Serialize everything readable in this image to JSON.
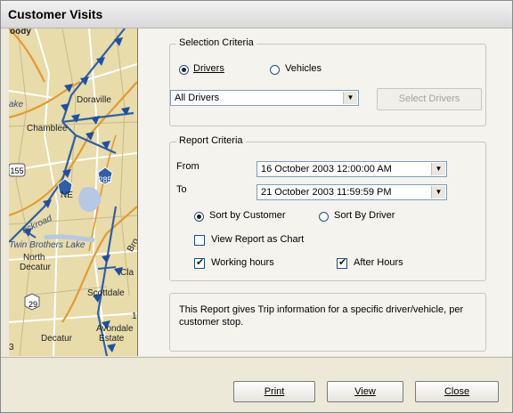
{
  "window": {
    "title": "Customer Visits"
  },
  "map": {
    "labels": {
      "top": "oody",
      "doraville": "Doraville",
      "lake": "ake",
      "chamblee": "Chamblee",
      "ne": "NE",
      "hwy155": "155",
      "hwy285": "285",
      "crossroad": "ackroad",
      "twin_brothers": "Twin Brothers Lake",
      "north_decatur_1": "North",
      "north_decatur_2": "Decatur",
      "cla": "Cla",
      "scottdale": "Scottdale",
      "hwy29": "29",
      "decatur": "Decatur",
      "avondale_1": "Avondale",
      "avondale_2": "Estate",
      "edge_1": "1",
      "edge_3": "3",
      "bro": "Bro"
    }
  },
  "selection_criteria": {
    "title": "Selection Criteria",
    "drivers_label": "Drivers",
    "vehicles_label": "Vehicles",
    "selected_mode": "Drivers",
    "driver_combo_value": "All Drivers",
    "select_button": "Select Drivers"
  },
  "report_criteria": {
    "title": "Report Criteria",
    "from_label": "From",
    "to_label": "To",
    "from_value": "16  October  2003  12:00:00 AM",
    "to_value": "21  October  2003  11:59:59 PM",
    "sort_customer_label": "Sort by Customer",
    "sort_driver_label": "Sort By Driver",
    "sort_selected": "Sort by Customer",
    "chart_label": "View Report as Chart",
    "chart_checked": false,
    "working_hours_label": "Working hours",
    "working_hours_checked": true,
    "after_hours_label": "After Hours",
    "after_hours_checked": true
  },
  "description": "This Report gives Trip information for a specific driver/vehicle, per customer stop.",
  "buttons": {
    "print": "Print",
    "view": "View",
    "close": "Close"
  },
  "colors": {
    "map_background": "#e7dcaa",
    "route": "#2e5fa8",
    "panel_background": "#f4f3ee",
    "window_background": "#ece9d8"
  }
}
